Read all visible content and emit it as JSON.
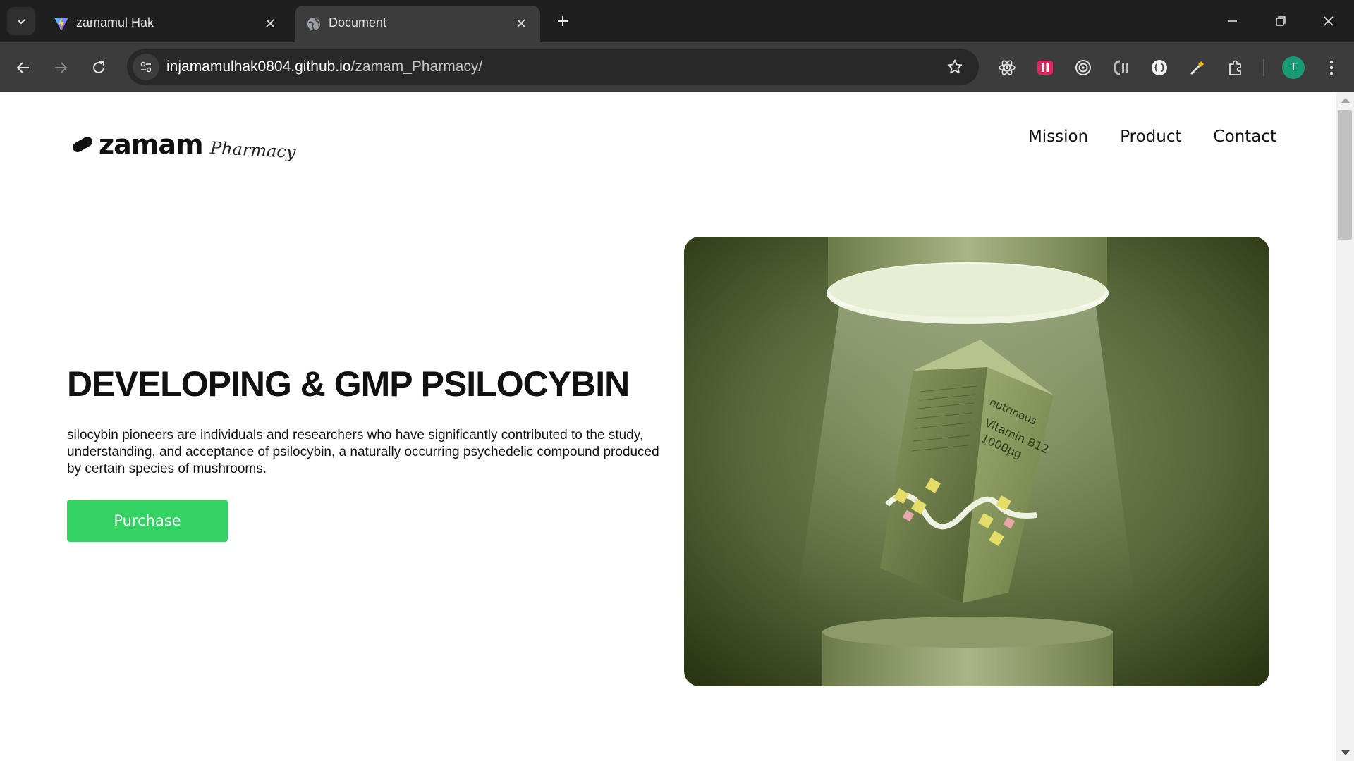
{
  "browser": {
    "tabs": [
      {
        "title": "zamamul Hak",
        "active": false,
        "icon": "vite-logo-icon"
      },
      {
        "title": "Document",
        "active": true,
        "icon": "globe-icon"
      }
    ],
    "url_host": "injamamulhak0804.github.io",
    "url_path": "/zamam_Pharmacy/",
    "profile_initial": "T",
    "colors": {
      "chrome_bg": "#1f1f1f",
      "toolbar_bg": "#3c3c3c",
      "profile": "#1a9a74"
    }
  },
  "page": {
    "logo": {
      "word": "zamam",
      "sub": "Pharmacy"
    },
    "nav": [
      "Mission",
      "Product",
      "Contact"
    ],
    "hero": {
      "title": "DEVELOPING & GMP PSILOCYBIN",
      "description": "silocybin pioneers are individuals and researchers who have significantly contributed to the study, understanding, and acceptance of psilocybin, a naturally occurring psychedelic compound produced by certain species of mushrooms.",
      "button": "Purchase"
    },
    "image": {
      "brand": "nutrinous",
      "product_line1": "Vitamin B12",
      "product_line2": "1000µg"
    },
    "colors": {
      "accent": "#33d263",
      "image_bg": "#56683a"
    }
  }
}
